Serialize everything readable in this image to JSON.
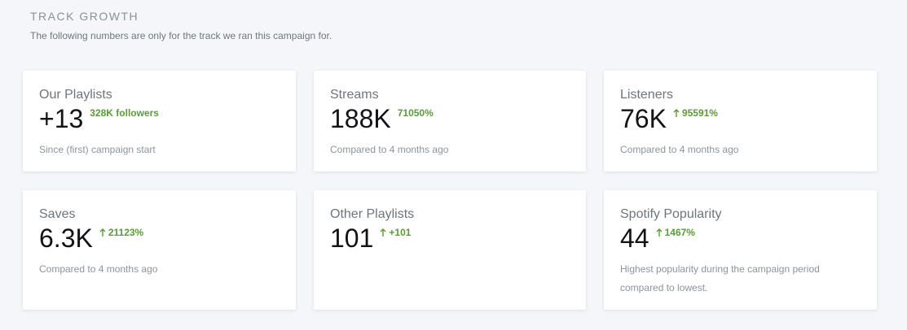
{
  "section": {
    "title": "TRACK GROWTH",
    "subtitle": "The following numbers are only for the track we ran this campaign for."
  },
  "colors": {
    "positive": "#5b9a37",
    "background": "#f4f6f9"
  },
  "cards": [
    {
      "label": "Our Playlists",
      "value": "+13",
      "change": "328K followers",
      "arrow": false,
      "note": "Since (first) campaign start"
    },
    {
      "label": "Streams",
      "value": "188K",
      "change": "71050%",
      "arrow": false,
      "note": "Compared to 4 months ago"
    },
    {
      "label": "Listeners",
      "value": "76K",
      "change": "95591%",
      "arrow": true,
      "note": "Compared to 4 months ago"
    },
    {
      "label": "Saves",
      "value": "6.3K",
      "change": "21123%",
      "arrow": true,
      "note": "Compared to 4 months ago"
    },
    {
      "label": "Other Playlists",
      "value": "101",
      "change": "+101",
      "arrow": true,
      "note": ""
    },
    {
      "label": "Spotify Popularity",
      "value": "44",
      "change": "1467%",
      "arrow": true,
      "note": "Highest popularity during the campaign period compared to lowest."
    }
  ]
}
